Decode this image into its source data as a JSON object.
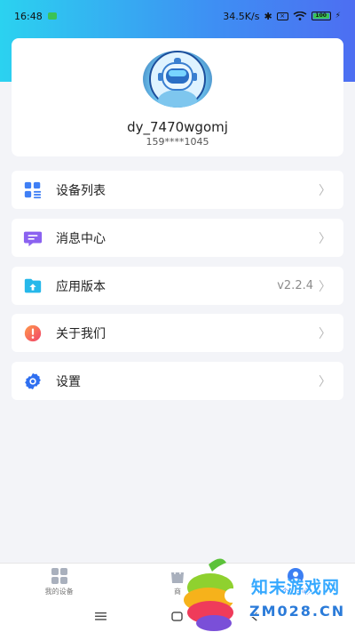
{
  "status_bar": {
    "time": "16:48",
    "network_speed": "34.5K/s",
    "battery_level": "100"
  },
  "profile": {
    "username": "dy_7470wgomj",
    "phone": "159****1045"
  },
  "menu": {
    "items": [
      {
        "label": "设备列表",
        "icon": "device-list-icon",
        "value": ""
      },
      {
        "label": "消息中心",
        "icon": "message-icon",
        "value": ""
      },
      {
        "label": "应用版本",
        "icon": "folder-upload-icon",
        "value": "v2.2.4"
      },
      {
        "label": "关于我们",
        "icon": "info-alert-icon",
        "value": ""
      },
      {
        "label": "设置",
        "icon": "gear-icon",
        "value": ""
      }
    ]
  },
  "bottom_nav": {
    "tabs": [
      {
        "label": "我的设备",
        "icon": "grid-icon"
      },
      {
        "label": "商",
        "icon": "shop-icon"
      },
      {
        "label": "个人中心",
        "icon": "user-icon"
      }
    ],
    "active_tab": "个人中心"
  },
  "watermark": {
    "line1": "知末游戏网",
    "line2": "ZM028.CN"
  },
  "colors": {
    "header_gradient_start": "#2bd2f0",
    "header_gradient_end": "#4d6ef2",
    "accent": "#3d7ff3",
    "background": "#f3f4f8"
  }
}
